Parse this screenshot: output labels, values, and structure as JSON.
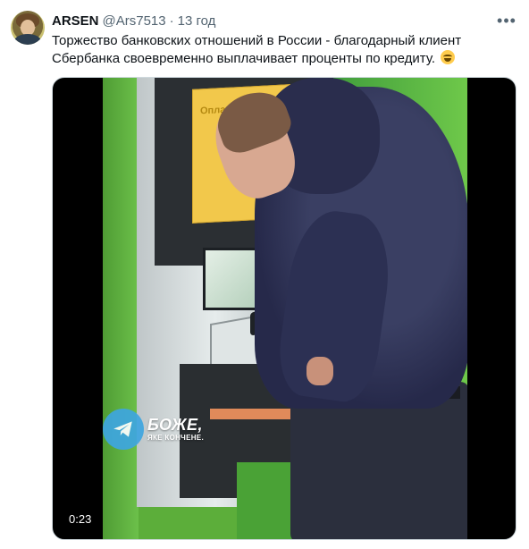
{
  "tweet": {
    "display_name": "ARSEN",
    "handle": "@Ars7513",
    "separator": "·",
    "time": "13 год",
    "more_icon": "more-horizontal-icon",
    "text_line_1": "Торжество банковских отношений в России - благодарный клиент",
    "text_line_2": "Сбербанка своевременно выплачивает проценты по кредиту.",
    "emoji": "face-with-tears-of-joy"
  },
  "media": {
    "type": "video",
    "duration": "0:23",
    "watermark": {
      "icon": "telegram-icon",
      "title": "БОЖЕ,",
      "subtitle": "ЯКЕ КОНЧЕНЕ."
    },
    "sign_text": "Оплати"
  }
}
